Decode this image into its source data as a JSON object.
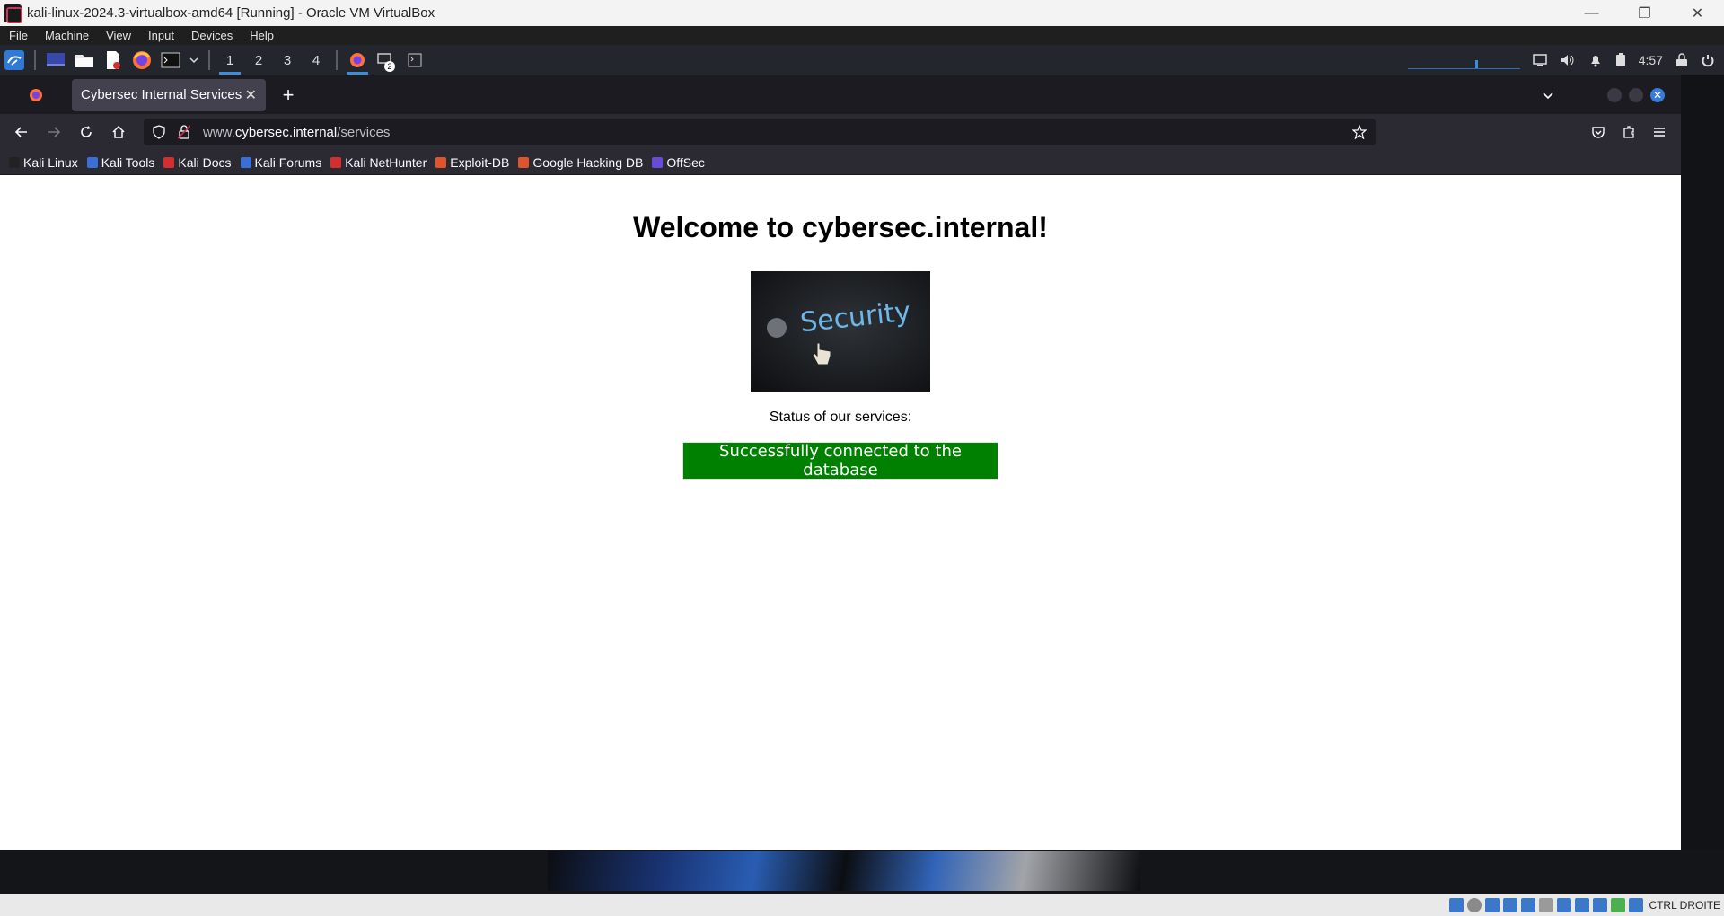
{
  "vbox": {
    "title": "kali-linux-2024.3-virtualbox-amd64 [Running] - Oracle VM VirtualBox",
    "menu": [
      "File",
      "Machine",
      "View",
      "Input",
      "Devices",
      "Help"
    ],
    "host_key": "CTRL DROITE"
  },
  "panel": {
    "workspaces": [
      "1",
      "2",
      "3",
      "4"
    ],
    "active_workspace": "1",
    "clock": "4:57",
    "badge_count": "2"
  },
  "browser": {
    "tab_title": "Cybersec Internal Services",
    "url_prefix": "www.",
    "url_host": "cybersec.internal",
    "url_path": "/services",
    "bookmarks": [
      {
        "label": "Kali Linux",
        "color": "#222222"
      },
      {
        "label": "Kali Tools",
        "color": "#3b6fd8"
      },
      {
        "label": "Kali Docs",
        "color": "#d32f2f"
      },
      {
        "label": "Kali Forums",
        "color": "#3b6fd8"
      },
      {
        "label": "Kali NetHunter",
        "color": "#d32f2f"
      },
      {
        "label": "Exploit-DB",
        "color": "#e0542b"
      },
      {
        "label": "Google Hacking DB",
        "color": "#e0542b"
      },
      {
        "label": "OffSec",
        "color": "#6a4bd8"
      }
    ]
  },
  "page": {
    "heading": "Welcome to cybersec.internal!",
    "image_text": "Security",
    "status_label": "Status of our services:",
    "status_message": "Successfully connected to the database",
    "status_color": "#008000"
  }
}
